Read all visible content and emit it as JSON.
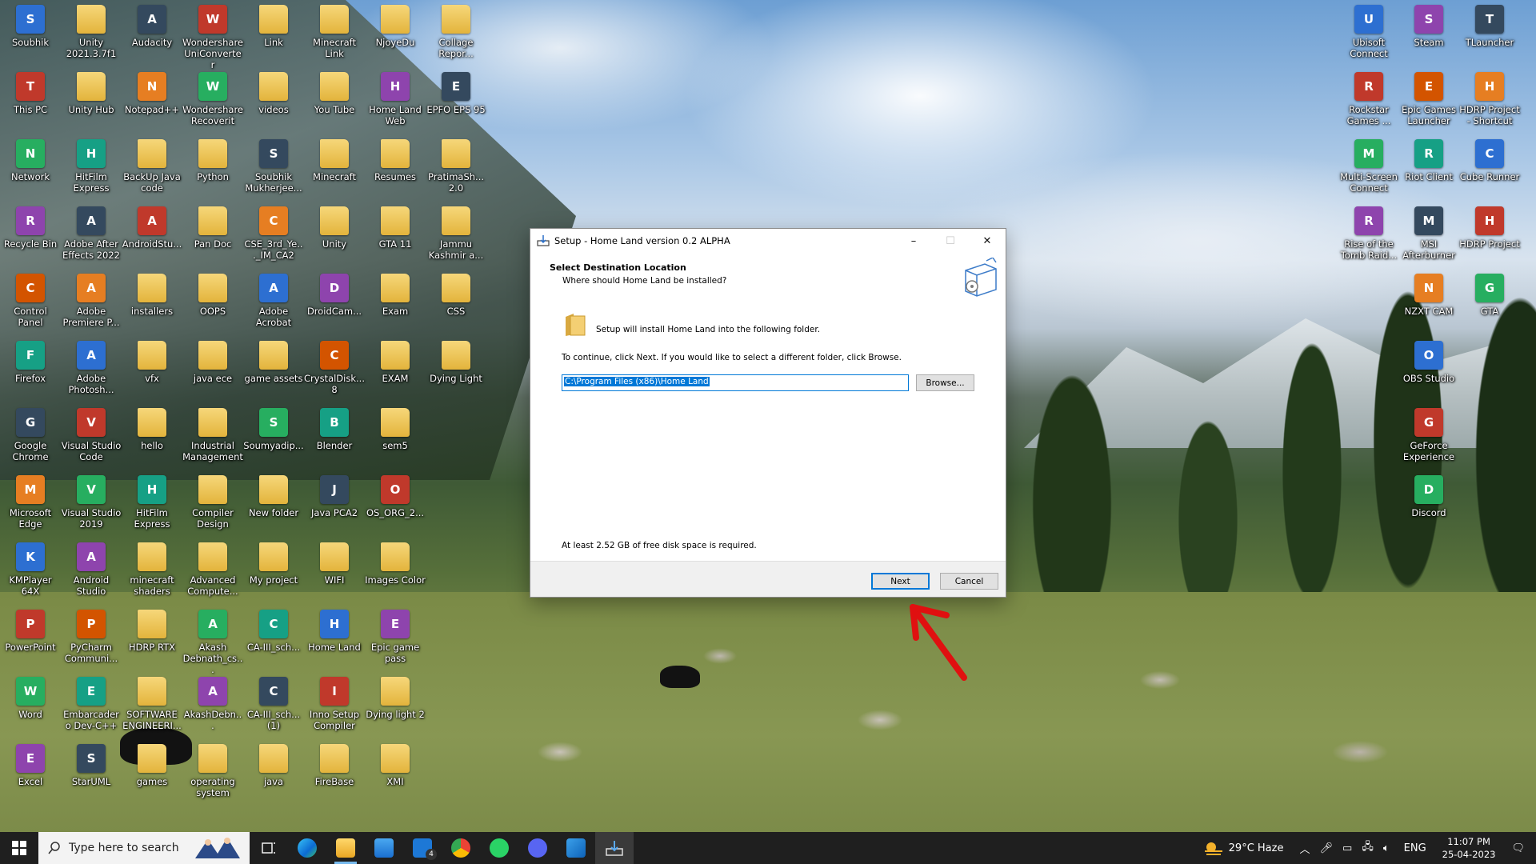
{
  "desktop": {
    "left_columns": [
      [
        "Soubhik",
        "This PC",
        "Network",
        "Recycle Bin",
        "Control Panel",
        "Firefox",
        "Google Chrome",
        "Microsoft Edge",
        "KMPlayer 64X",
        "PowerPoint",
        "Word",
        "Excel"
      ],
      [
        "Unity 2021.3.7f1",
        "Unity Hub",
        "HitFilm Express",
        "Adobe After Effects 2022",
        "Adobe Premiere P...",
        "Adobe Photosh...",
        "Visual Studio Code",
        "Visual Studio 2019",
        "Android Studio",
        "PyCharm Communi...",
        "Embarcadero Dev-C++",
        "StarUML"
      ],
      [
        "Audacity",
        "Notepad++",
        "BackUp Java code",
        "AndroidStu...",
        "installers",
        "vfx",
        "hello",
        "HitFilm Express",
        "minecraft shaders",
        "HDRP RTX",
        "SOFTWARE ENGINEERI...",
        "games"
      ],
      [
        "Wondershare UniConverter",
        "Wondershare Recoverit",
        "Python",
        "Pan Doc",
        "OOPS",
        "java ece",
        "Industrial Management",
        "Compiler Design",
        "Advanced Compute...",
        "Akash Debnath_cs...",
        "AkashDebn...",
        "operating system"
      ],
      [
        "Link",
        "videos",
        "Soubhik Mukherjee...",
        "CSE_3rd_Ye..._IM_CA2",
        "Adobe Acrobat",
        "game assets",
        "Soumyadip...",
        "New folder",
        "My project",
        "CA-III_sch...",
        "CA-III_sch... (1)",
        "java"
      ],
      [
        "Minecraft Link",
        "You Tube",
        "Minecraft",
        "Unity",
        "DroidCam...",
        "CrystalDisk... 8",
        "Blender",
        "Java PCA2",
        "WIFI",
        "Home Land",
        "Inno Setup Compiler",
        "FireBase"
      ],
      [
        "NjoyeDu",
        "Home Land Web",
        "Resumes",
        "GTA 11",
        "Exam",
        "EXAM",
        "sem5",
        "OS_ORG_2...",
        "Images Color",
        "Epic game pass",
        "Dying light 2",
        "XMI"
      ],
      [
        "Collage Repor...",
        "EPFO EPS 95",
        "PratimaSh... 2.0",
        "Jammu Kashmir a...",
        "CSS",
        "Dying Light"
      ]
    ],
    "right_columns": [
      [
        "Ubisoft Connect",
        "Rockstar Games ...",
        "Multi-Screen Connect",
        "Rise of the Tomb Raid..."
      ],
      [
        "Steam",
        "Epic Games Launcher",
        "Riot Client",
        "MSI Afterburner",
        "NZXT CAM",
        "OBS Studio",
        "GeForce Experience",
        "Discord"
      ],
      [
        "TLauncher",
        "HDRP Project - Shortcut",
        "Cube Runner",
        "HDRP Project",
        "GTA"
      ]
    ]
  },
  "dialog": {
    "title": "Setup - Home Land version 0.2 ALPHA",
    "heading": "Select Destination Location",
    "subheading": "Where should Home Land be installed?",
    "intro_text": "Setup will install Home Land into the following folder.",
    "continue_text": "To continue, click Next. If you would like to select a different folder, click Browse.",
    "install_path": "C:\\Program Files (x86)\\Home Land",
    "browse_label": "Browse...",
    "disk_space_text": "At least 2.52 GB of free disk space is required.",
    "next_label": "Next",
    "cancel_label": "Cancel",
    "minimize": "–",
    "maximize": "☐",
    "close": "✕"
  },
  "taskbar": {
    "search_placeholder": "Type here to search",
    "mail_badge": "4",
    "weather": "29°C  Haze",
    "language": "ENG",
    "time": "11:07 PM",
    "date": "25-04-2023"
  },
  "colors": {
    "accent": "#0078d7",
    "taskbar": "#1f1f1f",
    "annotation_arrow": "#e01010"
  }
}
